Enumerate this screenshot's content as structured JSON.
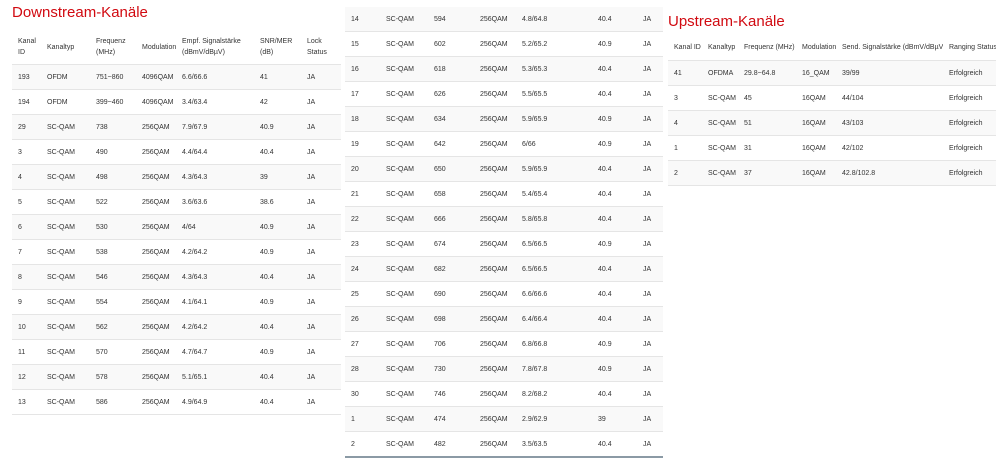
{
  "downstream": {
    "title": "Downstream-Kanäle",
    "headers": [
      [
        "Kanal",
        "ID"
      ],
      [
        "Kanaltyp"
      ],
      [
        "Frequenz",
        "(MHz)"
      ],
      [
        "Modulation"
      ],
      [
        "Empf. Signalstärke",
        "(dBmV/dBµV)"
      ],
      [
        "SNR/MER",
        "(dB)"
      ],
      [
        "Lock",
        "Status"
      ]
    ],
    "rows_left": [
      [
        "193",
        "OFDM",
        "751~860",
        "4096QAM",
        "6.6/66.6",
        "41",
        "JA"
      ],
      [
        "194",
        "OFDM",
        "399~460",
        "4096QAM",
        "3.4/63.4",
        "42",
        "JA"
      ],
      [
        "29",
        "SC-QAM",
        "738",
        "256QAM",
        "7.9/67.9",
        "40.9",
        "JA"
      ],
      [
        "3",
        "SC-QAM",
        "490",
        "256QAM",
        "4.4/64.4",
        "40.4",
        "JA"
      ],
      [
        "4",
        "SC-QAM",
        "498",
        "256QAM",
        "4.3/64.3",
        "39",
        "JA"
      ],
      [
        "5",
        "SC-QAM",
        "522",
        "256QAM",
        "3.6/63.6",
        "38.6",
        "JA"
      ],
      [
        "6",
        "SC-QAM",
        "530",
        "256QAM",
        "4/64",
        "40.9",
        "JA"
      ],
      [
        "7",
        "SC-QAM",
        "538",
        "256QAM",
        "4.2/64.2",
        "40.9",
        "JA"
      ],
      [
        "8",
        "SC-QAM",
        "546",
        "256QAM",
        "4.3/64.3",
        "40.4",
        "JA"
      ],
      [
        "9",
        "SC-QAM",
        "554",
        "256QAM",
        "4.1/64.1",
        "40.9",
        "JA"
      ],
      [
        "10",
        "SC-QAM",
        "562",
        "256QAM",
        "4.2/64.2",
        "40.4",
        "JA"
      ],
      [
        "11",
        "SC-QAM",
        "570",
        "256QAM",
        "4.7/64.7",
        "40.9",
        "JA"
      ],
      [
        "12",
        "SC-QAM",
        "578",
        "256QAM",
        "5.1/65.1",
        "40.4",
        "JA"
      ],
      [
        "13",
        "SC-QAM",
        "586",
        "256QAM",
        "4.9/64.9",
        "40.4",
        "JA"
      ]
    ],
    "rows_right": [
      [
        "14",
        "SC-QAM",
        "594",
        "256QAM",
        "4.8/64.8",
        "40.4",
        "JA"
      ],
      [
        "15",
        "SC-QAM",
        "602",
        "256QAM",
        "5.2/65.2",
        "40.9",
        "JA"
      ],
      [
        "16",
        "SC-QAM",
        "618",
        "256QAM",
        "5.3/65.3",
        "40.4",
        "JA"
      ],
      [
        "17",
        "SC-QAM",
        "626",
        "256QAM",
        "5.5/65.5",
        "40.4",
        "JA"
      ],
      [
        "18",
        "SC-QAM",
        "634",
        "256QAM",
        "5.9/65.9",
        "40.9",
        "JA"
      ],
      [
        "19",
        "SC-QAM",
        "642",
        "256QAM",
        "6/66",
        "40.9",
        "JA"
      ],
      [
        "20",
        "SC-QAM",
        "650",
        "256QAM",
        "5.9/65.9",
        "40.4",
        "JA"
      ],
      [
        "21",
        "SC-QAM",
        "658",
        "256QAM",
        "5.4/65.4",
        "40.4",
        "JA"
      ],
      [
        "22",
        "SC-QAM",
        "666",
        "256QAM",
        "5.8/65.8",
        "40.4",
        "JA"
      ],
      [
        "23",
        "SC-QAM",
        "674",
        "256QAM",
        "6.5/66.5",
        "40.9",
        "JA"
      ],
      [
        "24",
        "SC-QAM",
        "682",
        "256QAM",
        "6.5/66.5",
        "40.4",
        "JA"
      ],
      [
        "25",
        "SC-QAM",
        "690",
        "256QAM",
        "6.6/66.6",
        "40.4",
        "JA"
      ],
      [
        "26",
        "SC-QAM",
        "698",
        "256QAM",
        "6.4/66.4",
        "40.4",
        "JA"
      ],
      [
        "27",
        "SC-QAM",
        "706",
        "256QAM",
        "6.8/66.8",
        "40.9",
        "JA"
      ],
      [
        "28",
        "SC-QAM",
        "730",
        "256QAM",
        "7.8/67.8",
        "40.9",
        "JA"
      ],
      [
        "30",
        "SC-QAM",
        "746",
        "256QAM",
        "8.2/68.2",
        "40.4",
        "JA"
      ],
      [
        "1",
        "SC-QAM",
        "474",
        "256QAM",
        "2.9/62.9",
        "39",
        "JA"
      ],
      [
        "2",
        "SC-QAM",
        "482",
        "256QAM",
        "3.5/63.5",
        "40.4",
        "JA"
      ]
    ]
  },
  "upstream": {
    "title": "Upstream-Kanäle",
    "headers": [
      "Kanal ID",
      "Kanaltyp",
      "Frequenz (MHz)",
      "Modulation",
      "Send. Signalstärke (dBmV/dBµV)",
      "Ranging Status"
    ],
    "rows": [
      [
        "41",
        "OFDMA",
        "29.8~64.8",
        "16_QAM",
        "39/99",
        "Erfolgreich"
      ],
      [
        "3",
        "SC-QAM",
        "45",
        "16QAM",
        "44/104",
        "Erfolgreich"
      ],
      [
        "4",
        "SC-QAM",
        "51",
        "16QAM",
        "43/103",
        "Erfolgreich"
      ],
      [
        "1",
        "SC-QAM",
        "31",
        "16QAM",
        "42/102",
        "Erfolgreich"
      ],
      [
        "2",
        "SC-QAM",
        "37",
        "16QAM",
        "42.8/102.8",
        "Erfolgreich"
      ]
    ]
  }
}
